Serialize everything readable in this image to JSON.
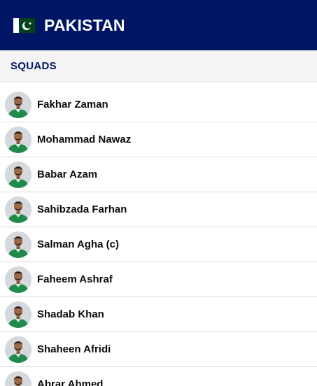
{
  "header": {
    "country": "PAKISTAN",
    "flag_icon": "pakistan-flag-icon"
  },
  "section": {
    "title": "SQUADS"
  },
  "colors": {
    "header_bg": "#001664",
    "section_bg": "#f4f4f4",
    "jersey": "#1f8a4c"
  },
  "players": [
    {
      "name": "Fakhar Zaman"
    },
    {
      "name": "Mohammad Nawaz"
    },
    {
      "name": "Babar Azam"
    },
    {
      "name": "Sahibzada Farhan"
    },
    {
      "name": "Salman Agha (c)"
    },
    {
      "name": "Faheem Ashraf"
    },
    {
      "name": "Shadab Khan"
    },
    {
      "name": "Shaheen Afridi"
    },
    {
      "name": "Abrar Ahmed"
    }
  ]
}
